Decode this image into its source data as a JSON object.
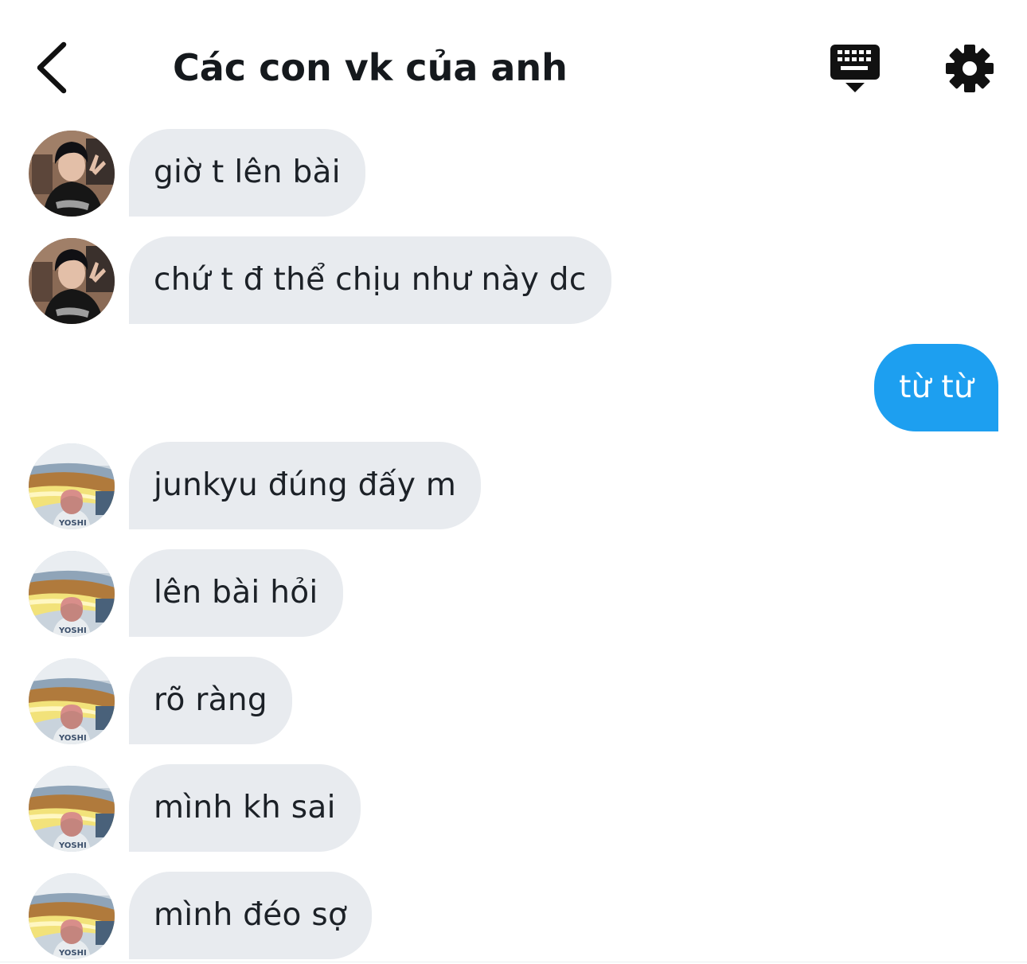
{
  "header": {
    "title": "Các con vk của anh",
    "back_icon": "chevron-left-icon",
    "keyboard_icon": "keyboard-icon",
    "settings_icon": "gear-icon"
  },
  "colors": {
    "incoming_bubble": "#e8ebef",
    "outgoing_bubble": "#1d9ff0",
    "text": "#1c2127"
  },
  "messages": [
    {
      "direction": "incoming",
      "sender": "avatar-1",
      "text": "giờ t lên bài"
    },
    {
      "direction": "incoming",
      "sender": "avatar-1",
      "text": "chứ t đ thể chịu như này dc"
    },
    {
      "direction": "outgoing",
      "text": "từ từ"
    },
    {
      "direction": "incoming",
      "sender": "avatar-2",
      "text": "junkyu đúng đấy m"
    },
    {
      "direction": "incoming",
      "sender": "avatar-2",
      "text": "lên bài hỏi"
    },
    {
      "direction": "incoming",
      "sender": "avatar-2",
      "text": "rõ ràng"
    },
    {
      "direction": "incoming",
      "sender": "avatar-2",
      "text": "mình kh sai"
    },
    {
      "direction": "incoming",
      "sender": "avatar-2",
      "text": "mình đéo sợ"
    }
  ]
}
